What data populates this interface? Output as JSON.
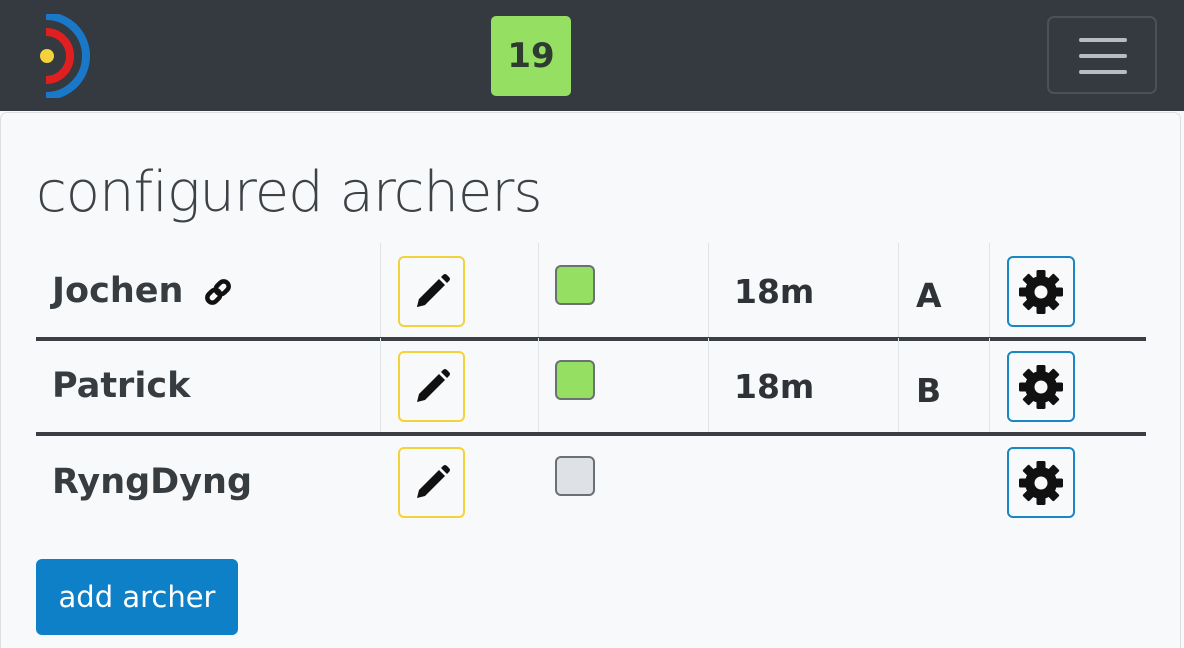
{
  "header": {
    "badge_count": "19",
    "logo_colors": [
      "#f3d23c",
      "#e02020",
      "#1a78c8"
    ],
    "menu_icon": "hamburger-icon"
  },
  "main": {
    "title": "configured archers",
    "archers": [
      {
        "name": "Jochen",
        "linked": true,
        "active": true,
        "distance": "18m",
        "group": "A"
      },
      {
        "name": "Patrick",
        "linked": false,
        "active": true,
        "distance": "18m",
        "group": "B"
      },
      {
        "name": "RyngDyng",
        "linked": false,
        "active": false,
        "distance": "",
        "group": ""
      }
    ],
    "add_button_label": "add archer"
  },
  "colors": {
    "navbar": "#343a40",
    "badge": "#95e063",
    "edit_border": "#f3d23c",
    "settings_border": "#1a86c3",
    "primary": "#0d80c8"
  }
}
